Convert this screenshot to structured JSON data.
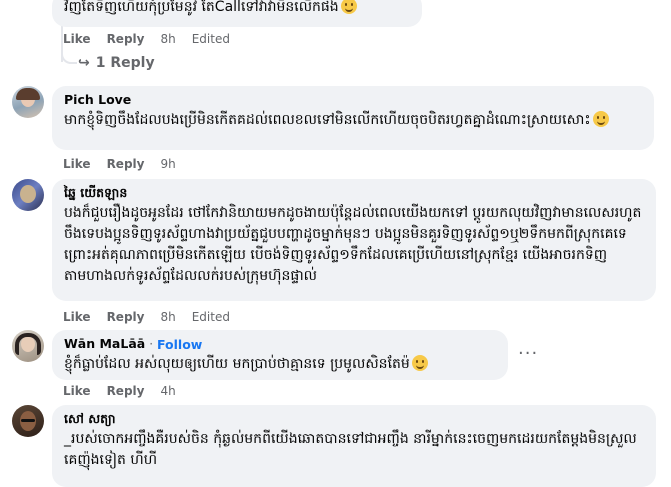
{
  "comments": [
    {
      "author": "",
      "text": "វិញតែទិញហើយកុំប្រមែនូវ តែCallទៅវាវាមិនលើកផង",
      "actions": {
        "like": "Like",
        "reply": "Reply",
        "time": "8h",
        "edited": "Edited"
      }
    },
    {
      "author": "Pich Love",
      "text": "មាកខ្ញុំទិញចឹងដែលបងប្រើមិនកើតគដល់ពេលខលទៅមិនលើកហើយចុចបិតរហ្វតគ្នាដំណោះស្រាយសោះ",
      "actions": {
        "like": "Like",
        "reply": "Reply",
        "time": "9h"
      }
    },
    {
      "author": "ឆ្នៃ យើតឡាន",
      "text": "បងក៏ជួបរឿងដូចអូនដែរ ថៅកែវានិយាយមកដូចងាយប៉ុន្តែដល់ពេលយើងយកទៅ ប្ដូរយកលុយវិញវាមានលេសរហូត ចឹងទេបងប្អូនទិញទូរស័ព្ទហាងវាប្រយ័ត្នជួបបញ្ហាដូចម្នាក់មុនៗ បងប្អូនមិនគួរទិញទូរស័ព្ទ១ឬ២ទឹកមកពីស្រុកគេទេព្រោះអត់គុណភាពប្រើមិនកើតឡើយ បើចង់ទិញទូរស័ព្ទ១ទឹកដែលគេប្រើហើយនៅស្រុកខ្មែរ យើងអាចរកទិញតាមហាងលក់ទូរស័ព្ទដែលលក់របស់ក្រុមហ៊ុនផ្ទាល់",
      "actions": {
        "like": "Like",
        "reply": "Reply",
        "time": "8h",
        "edited": "Edited"
      }
    },
    {
      "author": "Wān MaLāā",
      "follow": "Follow",
      "text": "ខ្ញុំក៏ធ្លាប់ដែល អស់លុយឲ្យហើយ មកប្រាប់ថាគ្មានទេ ប្រមូលសិនតែម៉",
      "actions": {
        "like": "Like",
        "reply": "Reply",
        "time": "4h"
      }
    },
    {
      "author": "សៅ សត្យា",
      "text": "_របស់ចោកអញ្ចឹងគឺរបស់ចិន កុំឆ្ងល់មកពីយើងឆោតបានទៅជាអញ្ចឹង នារីម្នាក់នេះចេញមកដេរយកតែម្ដងមិនស្រួលគេញ៉ុងទៀត ហីហី",
      "actions": {}
    }
  ],
  "reply_thread": {
    "label": "1 Reply"
  }
}
